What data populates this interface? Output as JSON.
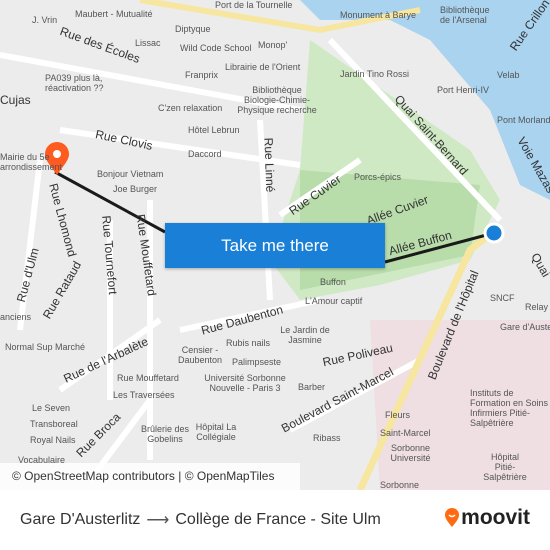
{
  "map": {
    "streets": [
      "Rue des Écoles",
      "Rue Clovis",
      "Rue Linné",
      "Rue Cuvier",
      "Allée Cuvier",
      "Allée Buffon",
      "Quai Saint-Bernard",
      "Rue Daubenton",
      "Rue Poliveau",
      "Boulevard Saint-Marcel",
      "Boulevard de l'Hôpital",
      "Rue Mouffetard",
      "Rue Tournefort",
      "Rue Lhomond",
      "Rue Rataud",
      "Rue d'Ulm",
      "Rue de l'Arbalète",
      "Rue Broca",
      "Rue Crillon",
      "Voie Mazas",
      "Cujas",
      "Quai"
    ],
    "places": [
      "Maubert - Mutualité",
      "J. Vrin",
      "Diptyque",
      "Lissac",
      "Wild Code School",
      "Monop'",
      "Librairie de l'Orient",
      "Franprix",
      "PA039 plus là, réactivation ??",
      "C'zen relaxation",
      "Bibliothèque Biologie-Chimie-Physique recherche",
      "Hôtel Lebrun",
      "Daccord",
      "Bonjour Vietnam",
      "Joe Burger",
      "Jardin Tino Rossi",
      "Port Henri-IV",
      "Pont Morland",
      "Velab",
      "Bibliothèque de l'Arsenal",
      "Monument à Barye",
      "Port de la Tournelle",
      "Porcs-épics",
      "Buffon",
      "L'Amour captif",
      "Le Jardin de Jasmine",
      "Rubis nails",
      "Censier - Daubenton",
      "Palimpseste",
      "Rue Mouffetard",
      "Université Sorbonne Nouvelle - Paris 3",
      "Les Traversées",
      "Barber",
      "Brûlerie des Gobelins",
      "Hôpital La Collégiale",
      "Ribass",
      "Fleurs",
      "Saint-Marcel",
      "Sorbonne Université",
      "Instituts de Formation en Soins Infirmiers Pitié-Salpêtrière",
      "Hôpital Pitié-Salpêtrière",
      "SNCF",
      "Relay",
      "Gare d'Austerlitz",
      "Normal Sup Marché",
      "Le Seven",
      "Transboreal",
      "Royal Nails",
      "Vocabulaire",
      "Mairie du 5e arrondissement",
      "Sorbonne",
      "anciens"
    ],
    "attribution": "© OpenStreetMap contributors | © OpenMapTiles",
    "cta_label": "Take me there",
    "route_color": "#1a1a1a",
    "origin_color": "#1a7fd6",
    "destination_color": "#ff5a1f"
  },
  "footer": {
    "origin": "Gare D'Austerlitz",
    "arrow": "⟶",
    "destination": "Collège de France - Site Ulm",
    "brand": "moovit"
  }
}
